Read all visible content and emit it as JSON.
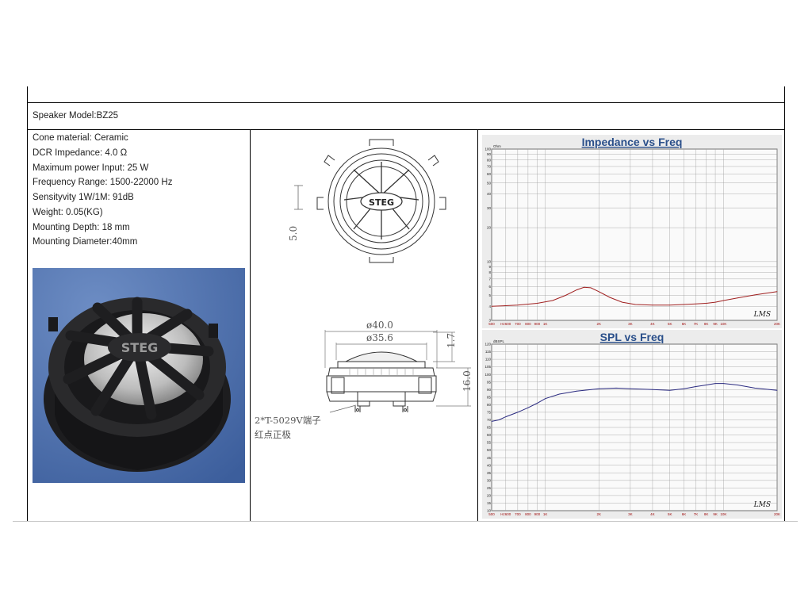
{
  "header": {
    "model": "Speaker Model:BZ25"
  },
  "specs": [
    "Cone material: Ceramic",
    "DCR Impedance: 4.0 Ω",
    "Maximum power Input: 25 W",
    "Frequency Range: 1500-22000 Hz",
    "Sensityvity 1W/1M: 91dB",
    "Weight: 0.05(KG)",
    "Mounting Depth: 18 mm",
    "Mounting Diameter:40mm"
  ],
  "photo": {
    "brand": "STEG"
  },
  "drawing": {
    "brand": "STEG",
    "dim_top_height": "5.0",
    "dim_outer_diameter": "ø40.0",
    "dim_inner_diameter": "ø35.6",
    "dim_cap_height": "1.7",
    "dim_depth": "16.0",
    "terminal_note_1": "2*T-5029V端子",
    "terminal_note_2": "红点正极"
  },
  "chart_data": [
    {
      "type": "line",
      "title": "Impedance vs Freq",
      "ylabel": "Ohm",
      "xscale": "log",
      "yscale": "log",
      "xlim": [
        500,
        20000
      ],
      "ylim": [
        3,
        100
      ],
      "x_tick_labels": [
        "500",
        "Hz600",
        "700",
        "800",
        "900",
        "1K",
        "2K",
        "3K",
        "4K",
        "5K",
        "6K",
        "7K",
        "8K",
        "9K",
        "10K",
        "20K"
      ],
      "y_tick_labels": [
        "100",
        "90",
        "80",
        "70",
        "60",
        "50",
        "40",
        "30",
        "20",
        "10",
        "9",
        "8",
        "7",
        "6",
        "5",
        "4",
        "3"
      ],
      "series": [
        {
          "color": "#a02020",
          "x": [
            500,
            700,
            900,
            1100,
            1300,
            1500,
            1650,
            1800,
            2000,
            2300,
            2700,
            3200,
            4000,
            5000,
            6000,
            7000,
            8000,
            9000,
            10000,
            12000,
            15000,
            20000
          ],
          "values": [
            4.0,
            4.1,
            4.25,
            4.5,
            5.0,
            5.6,
            5.9,
            5.85,
            5.4,
            4.8,
            4.35,
            4.15,
            4.1,
            4.1,
            4.15,
            4.2,
            4.25,
            4.35,
            4.5,
            4.75,
            5.05,
            5.4
          ]
        }
      ],
      "watermark": "LMS",
      "grid": true
    },
    {
      "type": "line",
      "title": "SPL vs Freq",
      "ylabel": "dBSPL",
      "xscale": "log",
      "xlim": [
        500,
        20000
      ],
      "ylim": [
        10,
        120
      ],
      "x_tick_labels": [
        "500",
        "Hz600",
        "700",
        "800",
        "900",
        "1K",
        "2K",
        "3K",
        "4K",
        "5K",
        "6K",
        "7K",
        "8K",
        "9K",
        "10K",
        "20K"
      ],
      "y_tick_labels": [
        "120",
        "115",
        "110",
        "105",
        "100",
        "95",
        "90",
        "85",
        "80",
        "75",
        "70",
        "65",
        "60",
        "55",
        "50",
        "45",
        "40",
        "35",
        "30",
        "25",
        "20",
        "15",
        "10"
      ],
      "series": [
        {
          "color": "#2a2a80",
          "x": [
            500,
            550,
            600,
            700,
            800,
            900,
            1000,
            1200,
            1500,
            2000,
            2500,
            3000,
            4000,
            5000,
            6000,
            7000,
            8000,
            9000,
            10000,
            12000,
            15000,
            20000
          ],
          "values": [
            69,
            70,
            72,
            75,
            78,
            81,
            84,
            87,
            89,
            90.5,
            91,
            90.5,
            90,
            89.5,
            90.5,
            92,
            93,
            94,
            94,
            93,
            91,
            89.5
          ]
        }
      ],
      "watermark": "LMS",
      "grid": true
    }
  ]
}
